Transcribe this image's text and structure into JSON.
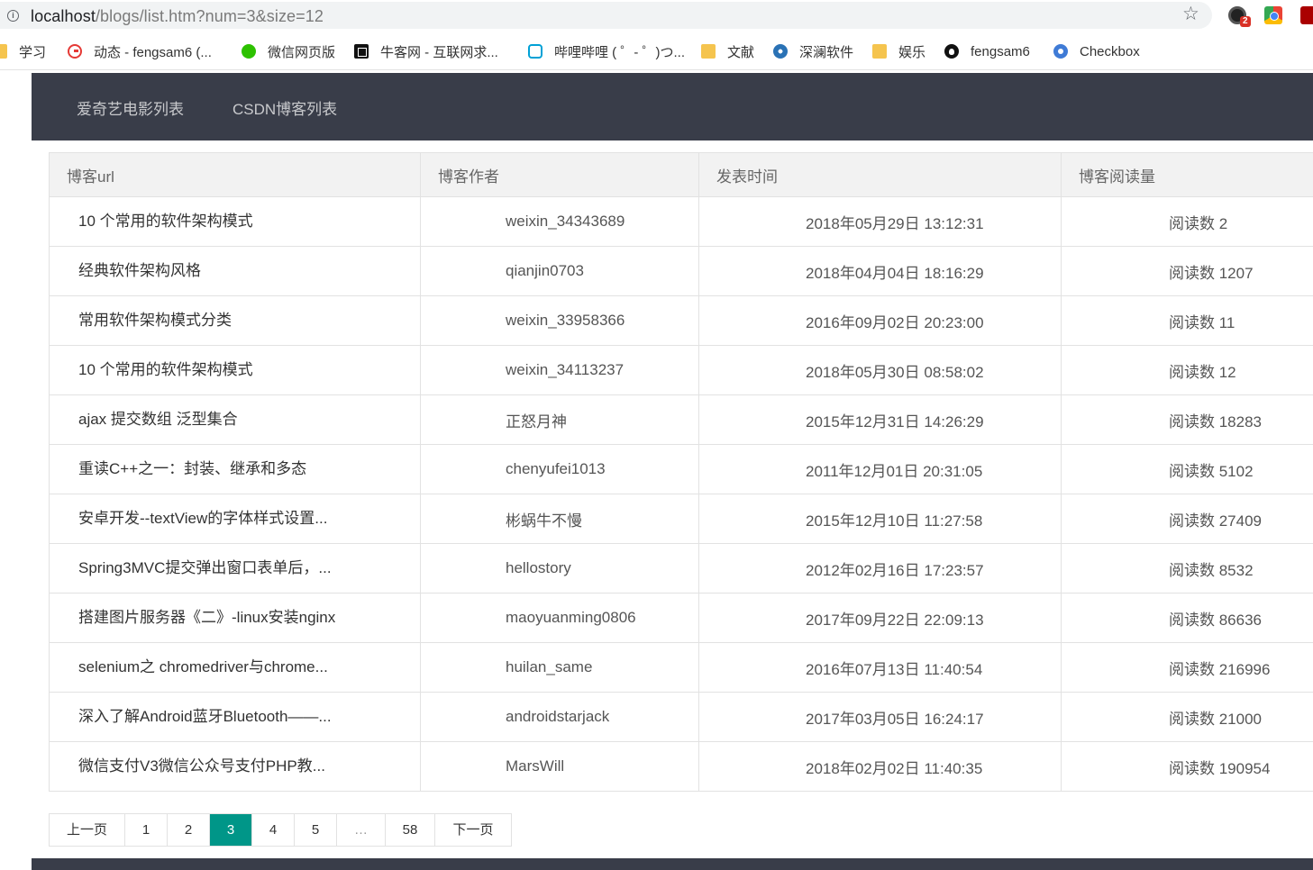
{
  "browser": {
    "url_host": "localhost",
    "url_path": "/blogs/list.htm?num=3&size=12",
    "ext_badge": "2"
  },
  "bookmarks": [
    {
      "label": "学习",
      "icon": "folder-icon"
    },
    {
      "label": "动态 - fengsam6 (...",
      "icon": "gitee-icon"
    },
    {
      "label": "微信网页版",
      "icon": "wechat-icon"
    },
    {
      "label": "牛客网 - 互联网求...",
      "icon": "nowcoder-icon"
    },
    {
      "label": "哔哩哔哩 ( ゜- ゜)つ...",
      "icon": "bilibili-icon"
    },
    {
      "label": "文献",
      "icon": "folder-icon"
    },
    {
      "label": "深澜软件",
      "icon": "srun-icon"
    },
    {
      "label": "娱乐",
      "icon": "folder-icon"
    },
    {
      "label": "fengsam6",
      "icon": "github-icon"
    },
    {
      "label": "Checkbox",
      "icon": "checkbox-icon"
    }
  ],
  "nav": {
    "item1": "爱奇艺电影列表",
    "item2": "CSDN博客列表"
  },
  "table": {
    "headers": [
      "博客url",
      "博客作者",
      "发表时间",
      "博客阅读量"
    ],
    "rows": [
      {
        "title": "10 个常用的软件架构模式",
        "author": "weixin_34343689",
        "time": "2018年05月29日 13:12:31",
        "reads": "阅读数 2"
      },
      {
        "title": "经典软件架构风格",
        "author": "qianjin0703",
        "time": "2018年04月04日 18:16:29",
        "reads": "阅读数 1207"
      },
      {
        "title": "常用软件架构模式分类",
        "author": "weixin_33958366",
        "time": "2016年09月02日 20:23:00",
        "reads": "阅读数 11"
      },
      {
        "title": "10 个常用的软件架构模式",
        "author": "weixin_34113237",
        "time": "2018年05月30日 08:58:02",
        "reads": "阅读数 12"
      },
      {
        "title": "ajax 提交数组 泛型集合",
        "author": "正怒月神",
        "time": "2015年12月31日 14:26:29",
        "reads": "阅读数 18283"
      },
      {
        "title": "重读C++之一：封装、继承和多态",
        "author": "chenyufei1013",
        "time": "2011年12月01日 20:31:05",
        "reads": "阅读数 5102"
      },
      {
        "title": "安卓开发--textView的字体样式设置...",
        "author": "彬蜗牛不慢",
        "time": "2015年12月10日 11:27:58",
        "reads": "阅读数 27409"
      },
      {
        "title": "Spring3MVC提交弹出窗口表单后，...",
        "author": "hellostory",
        "time": "2012年02月16日 17:23:57",
        "reads": "阅读数 8532"
      },
      {
        "title": "搭建图片服务器《二》-linux安装nginx",
        "author": "maoyuanming0806",
        "time": "2017年09月22日 22:09:13",
        "reads": "阅读数 86636"
      },
      {
        "title": "selenium之 chromedriver与chrome...",
        "author": "huilan_same",
        "time": "2016年07月13日 11:40:54",
        "reads": "阅读数 216996"
      },
      {
        "title": "深入了解Android蓝牙Bluetooth——...",
        "author": "androidstarjack",
        "time": "2017年03月05日 16:24:17",
        "reads": "阅读数 21000"
      },
      {
        "title": "微信支付V3微信公众号支付PHP教...",
        "author": "MarsWill",
        "time": "2018年02月02日 11:40:35",
        "reads": "阅读数 190954"
      }
    ]
  },
  "pager": {
    "prev": "上一页",
    "pages": [
      "1",
      "2",
      "3",
      "4",
      "5",
      "…",
      "58"
    ],
    "current": "3",
    "next": "下一页"
  },
  "colors": {
    "nav_bg": "#393d49",
    "pager_active": "#009688",
    "table_header_bg": "#f2f2f2"
  }
}
